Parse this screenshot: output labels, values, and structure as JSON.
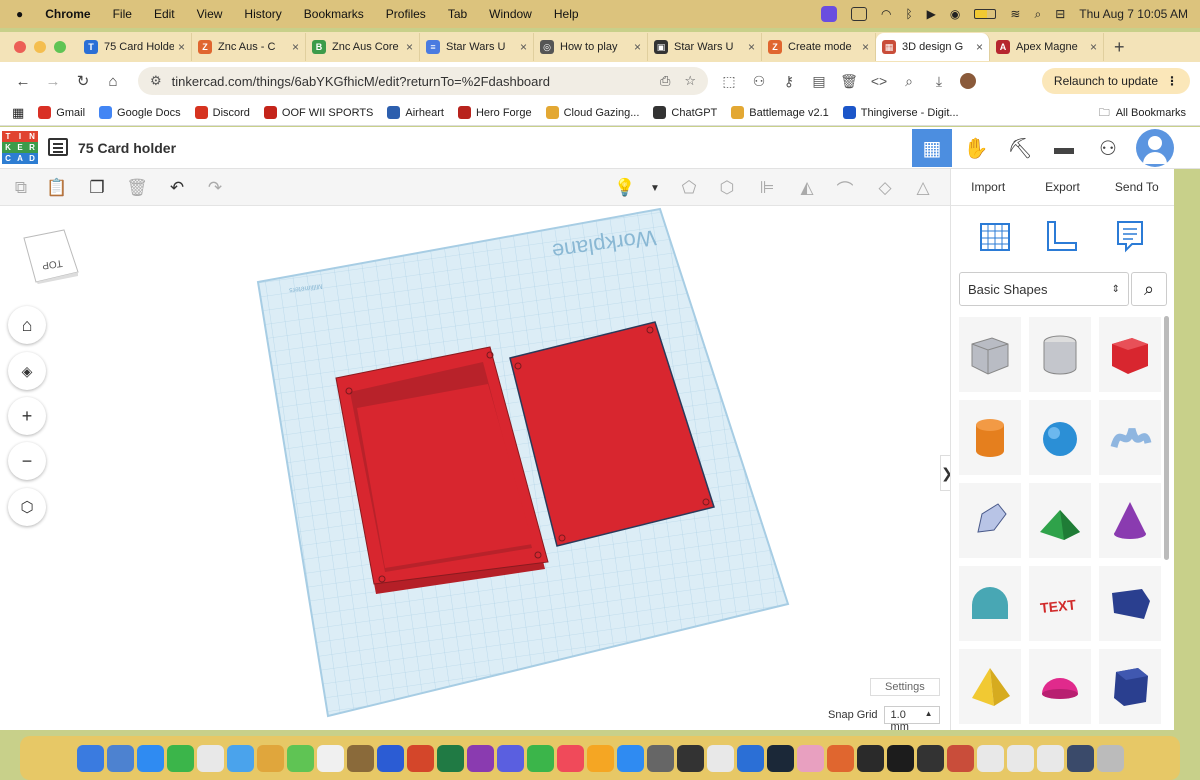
{
  "menubar": {
    "app": "Chrome",
    "items": [
      "File",
      "Edit",
      "View",
      "History",
      "Bookmarks",
      "Profiles",
      "Tab",
      "Window",
      "Help"
    ],
    "datetime": "Thu Aug 7  10:05 AM"
  },
  "tabs": [
    {
      "title": "75 Card Holder",
      "color": "#2b6fd6",
      "glyph": "T"
    },
    {
      "title": "Znc Aus - C",
      "color": "#e0662f",
      "glyph": "Z"
    },
    {
      "title": "Znc Aus Core",
      "color": "#3c9b4a",
      "glyph": "B"
    },
    {
      "title": "Star Wars U",
      "color": "#4a7be0",
      "glyph": "≡"
    },
    {
      "title": "How to play",
      "color": "#555555",
      "glyph": "◎"
    },
    {
      "title": "Star Wars U",
      "color": "#333333",
      "glyph": "▣"
    },
    {
      "title": "Create mode",
      "color": "#e0662f",
      "glyph": "Z"
    },
    {
      "title": "3D design G",
      "color": "#c94d3a",
      "glyph": "▦",
      "active": true
    },
    {
      "title": "Apex Magne",
      "color": "#b6262f",
      "glyph": "A"
    }
  ],
  "address": {
    "url": "tinkercad.com/things/6abYKGfhicM/edit?returnTo=%2Fdashboard",
    "relaunch": "Relaunch to update"
  },
  "bookmarks": [
    {
      "label": "Gmail",
      "color": "#d93025"
    },
    {
      "label": "Google Docs",
      "color": "#4285f4"
    },
    {
      "label": "Discord",
      "color": "#d6331f"
    },
    {
      "label": "OOF WII SPORTS",
      "color": "#c4241a"
    },
    {
      "label": "Airheart",
      "color": "#2d5fae"
    },
    {
      "label": "Hero Forge",
      "color": "#b8231d"
    },
    {
      "label": "Cloud Gazing...",
      "color": "#e3a833"
    },
    {
      "label": "ChatGPT",
      "color": "#333333"
    },
    {
      "label": "Battlemage v2.1",
      "color": "#e3a833"
    },
    {
      "label": "Thingiverse - Digit...",
      "color": "#1c56c9"
    }
  ],
  "all_bookmarks": "All Bookmarks",
  "logo": {
    "letters": [
      "T",
      "I",
      "N",
      "K",
      "E",
      "R",
      "C",
      "A",
      "D"
    ],
    "colors": [
      "#e0432f",
      "#e0432f",
      "#e0432f",
      "#3c9b4a",
      "#3c9b4a",
      "#3c9b4a",
      "#2d7dd2",
      "#2d7dd2",
      "#2d7dd2"
    ]
  },
  "design": {
    "title": "75 Card holder"
  },
  "panel": {
    "import": "Import",
    "export": "Export",
    "send_to": "Send To",
    "shape_category": "Basic Shapes"
  },
  "shapes": [
    {
      "name": "box-hole",
      "color": "#b9bcc4"
    },
    {
      "name": "cylinder-hole",
      "color": "#c4c6cc"
    },
    {
      "name": "box",
      "color": "#d8262f"
    },
    {
      "name": "cylinder",
      "color": "#e57f1e"
    },
    {
      "name": "sphere",
      "color": "#2b8fd6"
    },
    {
      "name": "scribble",
      "color": "#8fb6e0"
    },
    {
      "name": "polygon",
      "color": "#b8c4e6"
    },
    {
      "name": "roof",
      "color": "#2fa24a"
    },
    {
      "name": "cone",
      "color": "#8a3bb0"
    },
    {
      "name": "round-roof",
      "color": "#48a7b4"
    },
    {
      "name": "text",
      "color": "#d12a2a"
    },
    {
      "name": "wedge",
      "color": "#2a3f8f"
    },
    {
      "name": "pyramid",
      "color": "#f1c933"
    },
    {
      "name": "half-sphere",
      "color": "#e02a8c"
    },
    {
      "name": "hexagonal-prism",
      "color": "#2a3f8f"
    }
  ],
  "workplane": {
    "label": "Workplane",
    "units": "Millimeters"
  },
  "viewcube": {
    "face": "TOP"
  },
  "settings": "Settings",
  "snap": {
    "label": "Snap Grid",
    "value": "1.0 mm"
  },
  "colors": {
    "accent": "#4c8ee0",
    "model_red": "#d8262f",
    "workplane_fill": "#dcedf6"
  }
}
